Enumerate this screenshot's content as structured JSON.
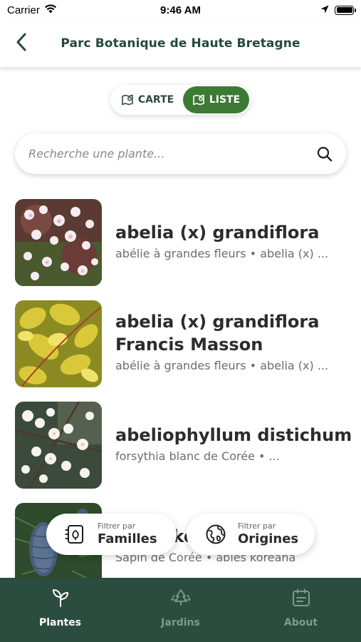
{
  "status_bar": {
    "carrier": "Carrier",
    "time": "9:46 AM"
  },
  "header": {
    "title": "Parc Botanique de Haute Bretagne"
  },
  "view_toggle": {
    "map_label": "CARTE",
    "list_label": "LISTE",
    "selected": "LISTE",
    "accent_color": "#3d7a35"
  },
  "search": {
    "placeholder": "Recherche une plante...",
    "value": ""
  },
  "plants": [
    {
      "name_line1": "abelia (x) grandiflora",
      "name_line2": "",
      "subtitle": "abélie à grandes fleurs • abelia (x) ...",
      "image": "white-pink-flowers-photo"
    },
    {
      "name_line1": "abelia (x) grandiflora",
      "name_line2": "Francis Masson",
      "subtitle": "abélie à grandes fleurs • abelia (x) ...",
      "image": "yellow-foliage-photo"
    },
    {
      "name_line1": "abeliophyllum distichum",
      "name_line2": "",
      "subtitle": "forsythia blanc de Corée • ...",
      "image": "white-blossom-branch-photo"
    },
    {
      "name_line1": "abies koreana",
      "name_line2": "",
      "subtitle": "Sapin de Corée • abies koreana",
      "image": "fir-cone-photo"
    }
  ],
  "filters": {
    "families": {
      "caption": "Filtrer par",
      "label": "Familles",
      "icon": "families-icon"
    },
    "origins": {
      "caption": "Filtrer par",
      "label": "Origines",
      "icon": "globe-icon"
    }
  },
  "tab_bar": {
    "background": "#2a4d40",
    "tabs": [
      {
        "label": "Plantes",
        "icon": "sprout-icon",
        "active": true
      },
      {
        "label": "Jardins",
        "icon": "trees-icon",
        "active": false
      },
      {
        "label": "About",
        "icon": "calendar-info-icon",
        "active": false
      }
    ]
  }
}
